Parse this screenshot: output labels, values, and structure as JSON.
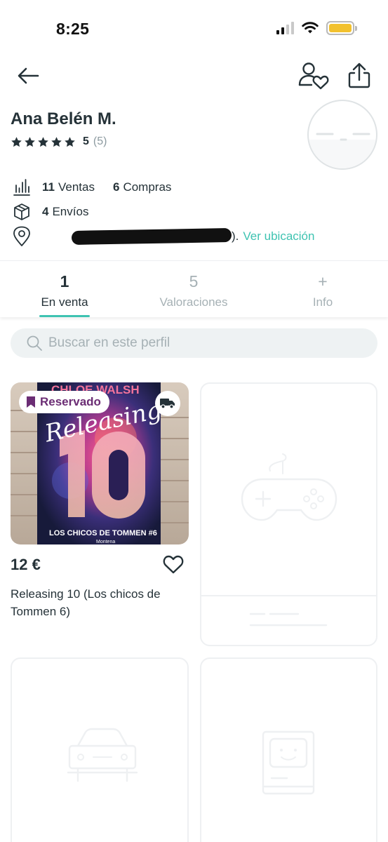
{
  "status_bar": {
    "time": "8:25"
  },
  "profile": {
    "name": "Ana Belén M.",
    "rating_value": "5",
    "rating_count": "(5)",
    "stars": 5,
    "sales_count": "11",
    "sales_label": "Ventas",
    "purchases_count": "6",
    "purchases_label": "Compras",
    "shipments_count": "4",
    "shipments_label": "Envíos",
    "location_suffix": ").",
    "location_link": "Ver ubicación"
  },
  "tabs": [
    {
      "count": "1",
      "label": "En venta",
      "active": true
    },
    {
      "count": "5",
      "label": "Valoraciones",
      "active": false
    },
    {
      "count": "+",
      "label": "Info",
      "active": false
    }
  ],
  "search": {
    "placeholder": "Buscar en este perfil"
  },
  "products": [
    {
      "badge": "Reservado",
      "price": "12 €",
      "title": "Releasing 10 (Los chicos de Tommen 6)",
      "cover_author": "CHLOE WALSH",
      "cover_title": "Releasing",
      "cover_number": "10",
      "cover_series": "LOS CHICOS DE TOMMEN #6",
      "cover_publisher": "Montena"
    }
  ],
  "colors": {
    "accent": "#3ec3b1",
    "reserved": "#6b2d74",
    "text": "#253238",
    "muted": "#a6b1b5",
    "battery": "#f2c12e"
  },
  "icons": [
    "back-arrow-icon",
    "follow-user-icon",
    "share-icon",
    "sales-chart-icon",
    "package-icon",
    "location-pin-icon",
    "search-icon",
    "bookmark-icon",
    "truck-icon",
    "heart-icon",
    "gamepad-icon",
    "car-icon",
    "computer-icon"
  ]
}
